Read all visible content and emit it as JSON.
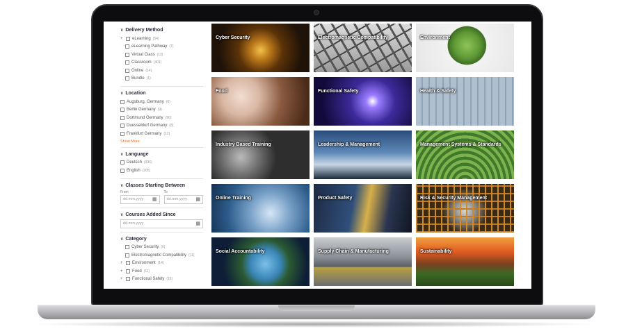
{
  "sidebar": {
    "delivery": {
      "title": "Delivery Method",
      "options": [
        {
          "label": "eLearning",
          "count": "(54)",
          "expandable": true
        },
        {
          "label": "eLearning Pathway",
          "count": "(7)",
          "indent": true
        },
        {
          "label": "Virtual Class",
          "count": "(13)",
          "indent": true
        },
        {
          "label": "Classroom",
          "count": "(401)",
          "indent": true
        },
        {
          "label": "Online",
          "count": "(14)",
          "indent": true
        },
        {
          "label": "Bundle",
          "count": "(1)",
          "indent": true
        }
      ]
    },
    "location": {
      "title": "Location",
      "options": [
        {
          "label": "Augsburg, Germany",
          "count": "(6)"
        },
        {
          "label": "Berlin Germany",
          "count": "(9)"
        },
        {
          "label": "Dortmund Germany",
          "count": "(90)"
        },
        {
          "label": "Duesseldorf Germany",
          "count": "(8)"
        },
        {
          "label": "Frankfurt Germany",
          "count": "(12)"
        }
      ],
      "show_more": "Show More"
    },
    "language": {
      "title": "Language",
      "options": [
        {
          "label": "Deutsch",
          "count": "(336)"
        },
        {
          "label": "English",
          "count": "(205)"
        }
      ]
    },
    "classes_starting": {
      "title": "Classes Starting Between",
      "from_label": "From",
      "to_label": "To",
      "from_placeholder": "dd.mm.yyyy",
      "to_placeholder": "dd.mm.yyyy"
    },
    "courses_added": {
      "title": "Courses Added Since",
      "placeholder": "dd.mm.yyyy"
    },
    "category": {
      "title": "Category",
      "options": [
        {
          "label": "Cyber Security",
          "count": "(6)",
          "indent": true
        },
        {
          "label": "Electromagnetic Compatibility",
          "count": "(11)",
          "indent": true
        },
        {
          "label": "Environment",
          "count": "(14)",
          "expandable": true
        },
        {
          "label": "Food",
          "count": "(11)",
          "expandable": true
        },
        {
          "label": "Functional Safety",
          "count": "(16)",
          "expandable": true
        }
      ]
    }
  },
  "tiles": [
    {
      "label": "Cyber Security",
      "art": "cyber"
    },
    {
      "label": "Electromagnetic Compatibility",
      "art": "emc"
    },
    {
      "label": "Environment",
      "art": "environment"
    },
    {
      "label": "Food",
      "art": "food"
    },
    {
      "label": "Functional Safety",
      "art": "functional"
    },
    {
      "label": "Health & Safety",
      "art": "health"
    },
    {
      "label": "Industry Based Training",
      "art": "industry"
    },
    {
      "label": "Leadership & Management",
      "art": "leadership"
    },
    {
      "label": "Management Systems & Standards",
      "art": "management"
    },
    {
      "label": "Online Training",
      "art": "online"
    },
    {
      "label": "Product Safety",
      "art": "product"
    },
    {
      "label": "Risk & Security Management",
      "art": "risk"
    },
    {
      "label": "Social Accountability",
      "art": "social"
    },
    {
      "label": "Supply Chain & Manufacturing",
      "art": "supply"
    },
    {
      "label": "Sustainability",
      "art": "sustainability"
    }
  ],
  "colors": {
    "accent": "#e07030",
    "heading": "#2a2a3a",
    "device_frame": "#0d0d0f"
  }
}
